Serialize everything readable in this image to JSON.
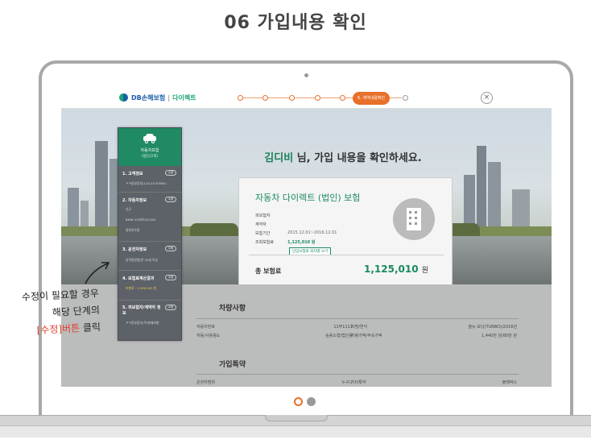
{
  "page_title": "06 가입내용 확인",
  "app": {
    "logo_text": "DB손해보험",
    "logo_separator": "|",
    "logo_sub": "다이렉트",
    "active_step": "6. 계약내용확인",
    "close_symbol": "×"
  },
  "hero": {
    "customer_name": "김디비",
    "greeting_suffix": " 님, 가입 내용을 확인하세요."
  },
  "card": {
    "title": "자동차 다이렉트 (법인) 보험",
    "rows": [
      {
        "label": "피보험자",
        "value": ""
      },
      {
        "label": "계약자",
        "value": ""
      },
      {
        "label": "보험기간",
        "value": "2015.12.01~2016.12.01"
      },
      {
        "label": "조회보험료",
        "value": "1,125,010 원"
      }
    ],
    "detail_button": "납입보험료 회차별 보기",
    "total_label": "총 보험료",
    "total_value": "1,125,010",
    "total_unit": "원"
  },
  "vehicle": {
    "title": "차량사항",
    "rows": [
      {
        "l1": "자동차번호",
        "v1": "11부1111",
        "l2": "차명/연식",
        "v2": "올뉴 모닝(TURBO)/2016년"
      },
      {
        "l1": "자동/사용용도",
        "v1": "승용소형/법인용",
        "l2": "차량가액/부속가액",
        "v2": "1,440만 원/80만 원"
      }
    ]
  },
  "coverage": {
    "title": "가입특약",
    "row": {
      "l1": "운전자범위",
      "v1": "누구나",
      "l2": "기타특약",
      "v2": "블랙박스"
    }
  },
  "sidebar": {
    "head_title": "자동차보험",
    "head_sub": "(법인고객)",
    "edit_label": "수정",
    "items": [
      {
        "label": "1. 고객정보",
        "subs": [
          "ㅋㅋ동부동부(123-45-67890)"
        ]
      },
      {
        "label": "2. 자동차정보",
        "subs": [
          "신규",
          "BMW 3시리즈/2015A",
          "일반자우용"
        ]
      },
      {
        "label": "3. 운전자정보",
        "subs": [
          "임직원한정/만 30세 이상"
        ]
      },
      {
        "label": "4. 보험료계산결과",
        "subs": [
          "보험료 : 1,300,000 원"
        ]
      },
      {
        "label": "5. 피보험자/계약자 정보",
        "subs": [
          "ㅋㅋ동부동부(주)화재보험"
        ]
      }
    ]
  },
  "annotation": {
    "line1": "수정이 필요할 경우",
    "line2": "해당 단계의",
    "line3_red": "[수정]버튼",
    "line3_rest": " 클릭"
  },
  "colors": {
    "brand_green": "#1a8b5f",
    "accent_orange": "#e8702a"
  }
}
